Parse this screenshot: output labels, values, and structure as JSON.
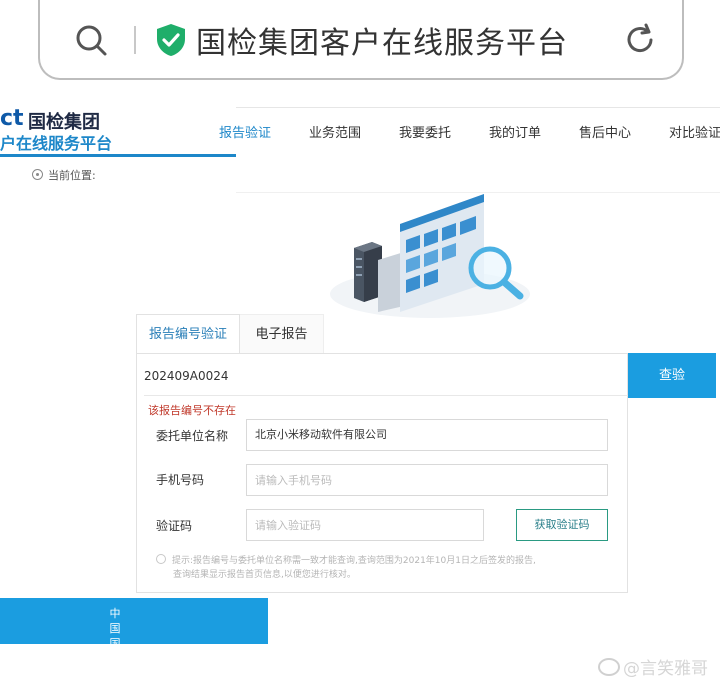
{
  "browser": {
    "address_title": "国检集团客户在线服务平台",
    "icons": {
      "search": "search-icon",
      "secure": "shield-check-icon",
      "reload": "reload-icon"
    }
  },
  "site": {
    "logo_mark": "ct",
    "logo_brand": "国检集团",
    "logo_sub": "户在线服务平台"
  },
  "nav": {
    "items": [
      "报告验证",
      "业务范围",
      "我要委托",
      "我的订单",
      "售后中心",
      "对比验证"
    ],
    "active_index": 0
  },
  "breadcrumb": {
    "label": "当前位置:"
  },
  "tabs": {
    "items": [
      "报告编号验证",
      "电子报告"
    ],
    "active_index": 0
  },
  "form": {
    "report_number": "202409A0024",
    "query_button": "查验",
    "error": "该报告编号不存在",
    "company_label": "委托单位名称",
    "company_value": "北京小米移动软件有限公司",
    "phone_label": "手机号码",
    "phone_placeholder": "请输入手机号码",
    "code_label": "验证码",
    "code_placeholder": "请输入验证码",
    "code_button": "获取验证码",
    "hint_line1": "提示:报告编号与委托单位名称需一致才能查询,查询范围为2021年10月1日之后签发的报告,",
    "hint_line2": "查询结果显示报告首页信息,以便您进行核对。"
  },
  "footer": {
    "vertical_text": [
      "中",
      "国",
      "国"
    ]
  },
  "watermark": {
    "text": "@言笑雅哥"
  },
  "colors": {
    "accent": "#1b9de0",
    "nav_active": "#1d87c9",
    "error": "#c0392b",
    "brand_dark": "#1f2a44"
  }
}
